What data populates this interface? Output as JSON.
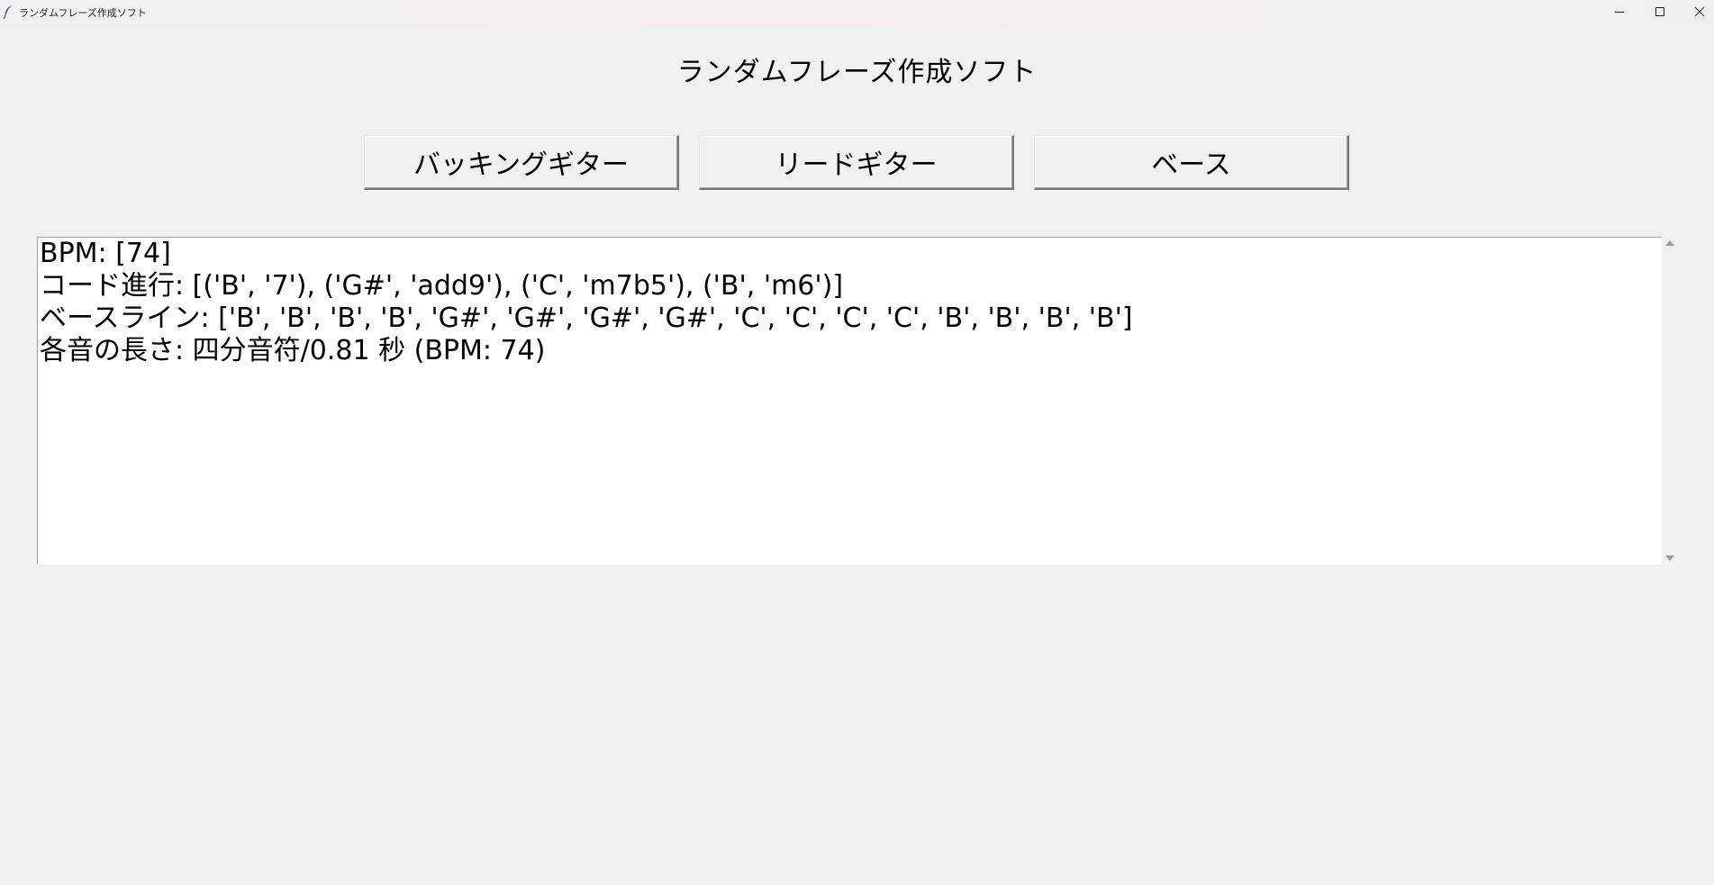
{
  "window": {
    "title": "ランダムフレーズ作成ソフト"
  },
  "main": {
    "heading": "ランダムフレーズ作成ソフト",
    "buttons": [
      {
        "label": "バッキングギター"
      },
      {
        "label": "リードギター"
      },
      {
        "label": "ベース"
      }
    ],
    "output_lines": [
      "BPM: [74]",
      "コード進行: [('B', '7'), ('G#', 'add9'), ('C', 'm7b5'), ('B', 'm6')]",
      "ベースライン: ['B', 'B', 'B', 'B', 'G#', 'G#', 'G#', 'G#', 'C', 'C', 'C', 'C', 'B', 'B', 'B', 'B']",
      "各音の長さ: 四分音符/0.81 秒 (BPM: 74)"
    ]
  },
  "icons": {
    "app": "feather-icon",
    "minimize": "minimize-icon",
    "maximize": "maximize-icon",
    "close": "close-icon"
  }
}
